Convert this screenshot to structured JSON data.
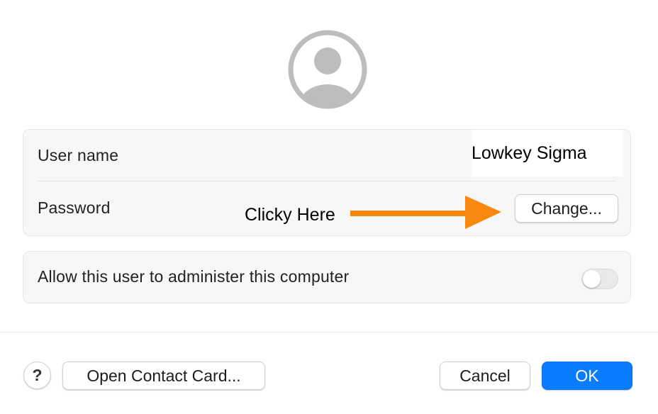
{
  "avatar": {
    "icon": "person-circle-icon"
  },
  "account": {
    "username_label": "User name",
    "username_value": "Lowkey Sigma",
    "password_label": "Password",
    "change_button": "Change..."
  },
  "annotation": {
    "text": "Clicky Here",
    "arrow_color": "#f7870f",
    "arrow_icon": "arrow-right-icon"
  },
  "admin": {
    "label": "Allow this user to administer this computer",
    "enabled": false
  },
  "footer": {
    "help_label": "?",
    "open_contact_card": "Open Contact Card...",
    "cancel": "Cancel",
    "ok": "OK"
  },
  "colors": {
    "accent": "#0a7cff",
    "group_background": "#f7f7f7",
    "avatar_gray": "#bdbdbd"
  }
}
